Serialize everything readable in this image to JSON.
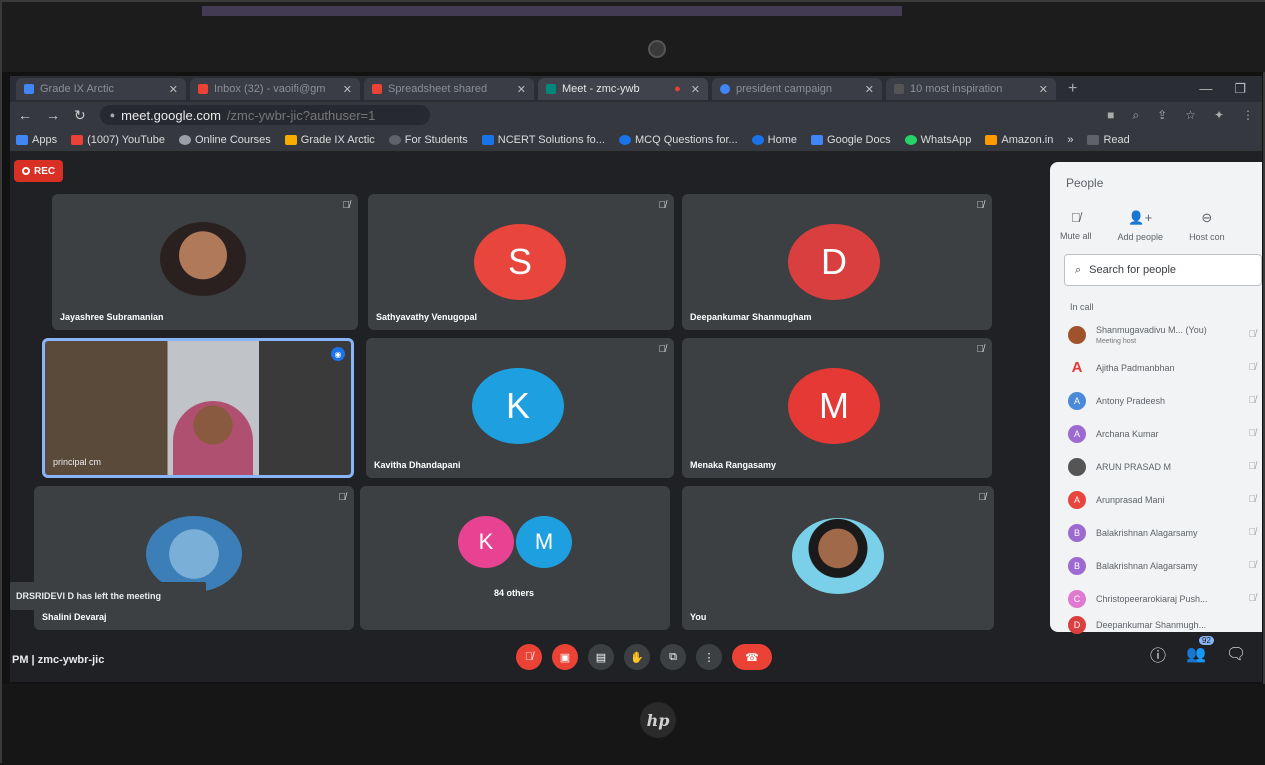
{
  "browser": {
    "tabs": [
      {
        "label": "Grade IX Arctic",
        "color": "#4285f4"
      },
      {
        "label": "Inbox (32) - vaoifi@gm",
        "color": "#ea4335"
      },
      {
        "label": "Spreadsheet shared",
        "color": "#ea4335"
      },
      {
        "label": "Meet - zmc-ywb",
        "color": "#00897b",
        "active": true
      },
      {
        "label": "president campaign",
        "color": "#4285f4"
      },
      {
        "label": "10 most inspiration",
        "color": "#555555"
      }
    ],
    "url_host": "meet.google.com",
    "url_path": "/zmc-ywbr-jic?authuser=1",
    "bookmarks": [
      {
        "label": "Apps",
        "color": "#4285f4"
      },
      {
        "label": "(1007) YouTube",
        "color": "#ea4335"
      },
      {
        "label": "Online Courses",
        "color": "#9aa0a6"
      },
      {
        "label": "Grade IX Arctic",
        "color": "#f9ab00"
      },
      {
        "label": "For Students",
        "color": "#5f6368"
      },
      {
        "label": "NCERT Solutions fo...",
        "color": "#1a73e8"
      },
      {
        "label": "MCQ Questions for...",
        "color": "#1a73e8"
      },
      {
        "label": "Home",
        "color": "#1a73e8"
      },
      {
        "label": "Google Docs",
        "color": "#4285f4"
      },
      {
        "label": "WhatsApp",
        "color": "#25d366"
      },
      {
        "label": "Amazon.in",
        "color": "#ff9900"
      },
      {
        "label": "»",
        "color": ""
      },
      {
        "label": "Read",
        "color": "#5f6368"
      }
    ]
  },
  "meet": {
    "rec_label": "REC",
    "tiles": [
      {
        "name": "Jayashree Subramanian"
      },
      {
        "name": "Sathyavathy Venugopal",
        "initial": "S",
        "color": "#e8453c"
      },
      {
        "name": "Deepankumar Shanmugham",
        "initial": "D",
        "color": "#d93f3f"
      },
      {
        "name": "principal cm"
      },
      {
        "name": "Kavitha Dhandapani",
        "initial": "K",
        "color": "#1ea0e0"
      },
      {
        "name": "Menaka Rangasamy",
        "initial": "M",
        "color": "#e53935"
      },
      {
        "name": "Shalini Devaraj"
      },
      {
        "name": "84 others",
        "initial_a": "K",
        "initial_b": "M"
      },
      {
        "name": "You"
      }
    ],
    "toast": "DRSRIDEVI D has left the meeting",
    "meeting_code": "PM | zmc-ywbr-jic",
    "people_count": "92"
  },
  "people_panel": {
    "title": "People",
    "actions": [
      "Mute all",
      "Add people",
      "Host con"
    ],
    "search_placeholder": "Search for people",
    "section": "In call",
    "participants": [
      {
        "name": "Shanmugavadivu M... (You)",
        "sub": "Meeting host",
        "initial": "",
        "color": "#a0522d"
      },
      {
        "name": "Ajitha Padmanbhan",
        "initial": "A",
        "color": "#e53935"
      },
      {
        "name": "Antony Pradeesh",
        "initial": "A",
        "color": "#4a8ad8"
      },
      {
        "name": "Archana Kumar",
        "initial": "A",
        "color": "#9c6ad0"
      },
      {
        "name": "ARUN PRASAD M",
        "initial": "",
        "color": "#555555"
      },
      {
        "name": "Arunprasad Mani",
        "initial": "A",
        "color": "#e8453c"
      },
      {
        "name": "Balakrishnan Alagarsamy",
        "initial": "B",
        "color": "#9c6ad0"
      },
      {
        "name": "Balakrishnan Alagarsamy",
        "initial": "B",
        "color": "#9c6ad0"
      },
      {
        "name": "Christopeerarokiaraj Push...",
        "initial": "C",
        "color": "#e07ad0"
      },
      {
        "name": "Deepankumar Shanmugh...",
        "initial": "D",
        "color": "#d93f3f"
      }
    ]
  },
  "laptop": {
    "logo": "hp"
  }
}
